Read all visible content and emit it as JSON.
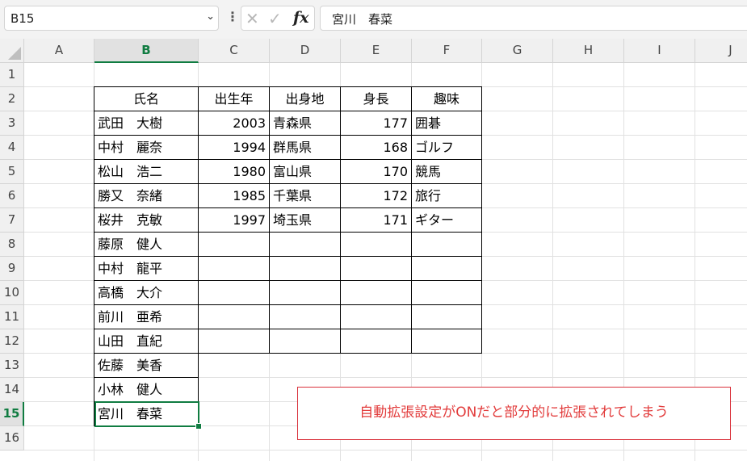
{
  "formula_bar": {
    "name_box": "B15",
    "formula": "宮川　春菜",
    "fx_label": "fx"
  },
  "columns": [
    "A",
    "B",
    "C",
    "D",
    "E",
    "F",
    "G",
    "H",
    "I",
    "J"
  ],
  "rows": [
    "1",
    "2",
    "3",
    "4",
    "5",
    "6",
    "7",
    "8",
    "9",
    "10",
    "11",
    "12",
    "13",
    "14",
    "15",
    "16"
  ],
  "active_cell": {
    "column": "B",
    "row": "15"
  },
  "table": {
    "headers": [
      "氏名",
      "出生年",
      "出身地",
      "身長",
      "趣味"
    ],
    "rows": [
      [
        "武田　大樹",
        "2003",
        "青森県",
        "177",
        "囲碁"
      ],
      [
        "中村　麗奈",
        "1994",
        "群馬県",
        "168",
        "ゴルフ"
      ],
      [
        "松山　浩二",
        "1980",
        "富山県",
        "170",
        "競馬"
      ],
      [
        "勝又　奈緒",
        "1985",
        "千葉県",
        "172",
        "旅行"
      ],
      [
        "桜井　克敏",
        "1997",
        "埼玉県",
        "171",
        "ギター"
      ],
      [
        "藤原　健人",
        "",
        "",
        "",
        ""
      ],
      [
        "中村　龍平",
        "",
        "",
        "",
        ""
      ],
      [
        "高橋　大介",
        "",
        "",
        "",
        ""
      ],
      [
        "前川　亜希",
        "",
        "",
        "",
        ""
      ],
      [
        "山田　直紀",
        "",
        "",
        "",
        ""
      ],
      [
        "佐藤　美香"
      ],
      [
        "小林　健人"
      ],
      [
        "宮川　春菜"
      ]
    ]
  },
  "callout": "自動拡張設定がONだと部分的に拡張されてしまう",
  "colors": {
    "accent_green": "#107c41",
    "callout_red": "#e23b3b"
  }
}
